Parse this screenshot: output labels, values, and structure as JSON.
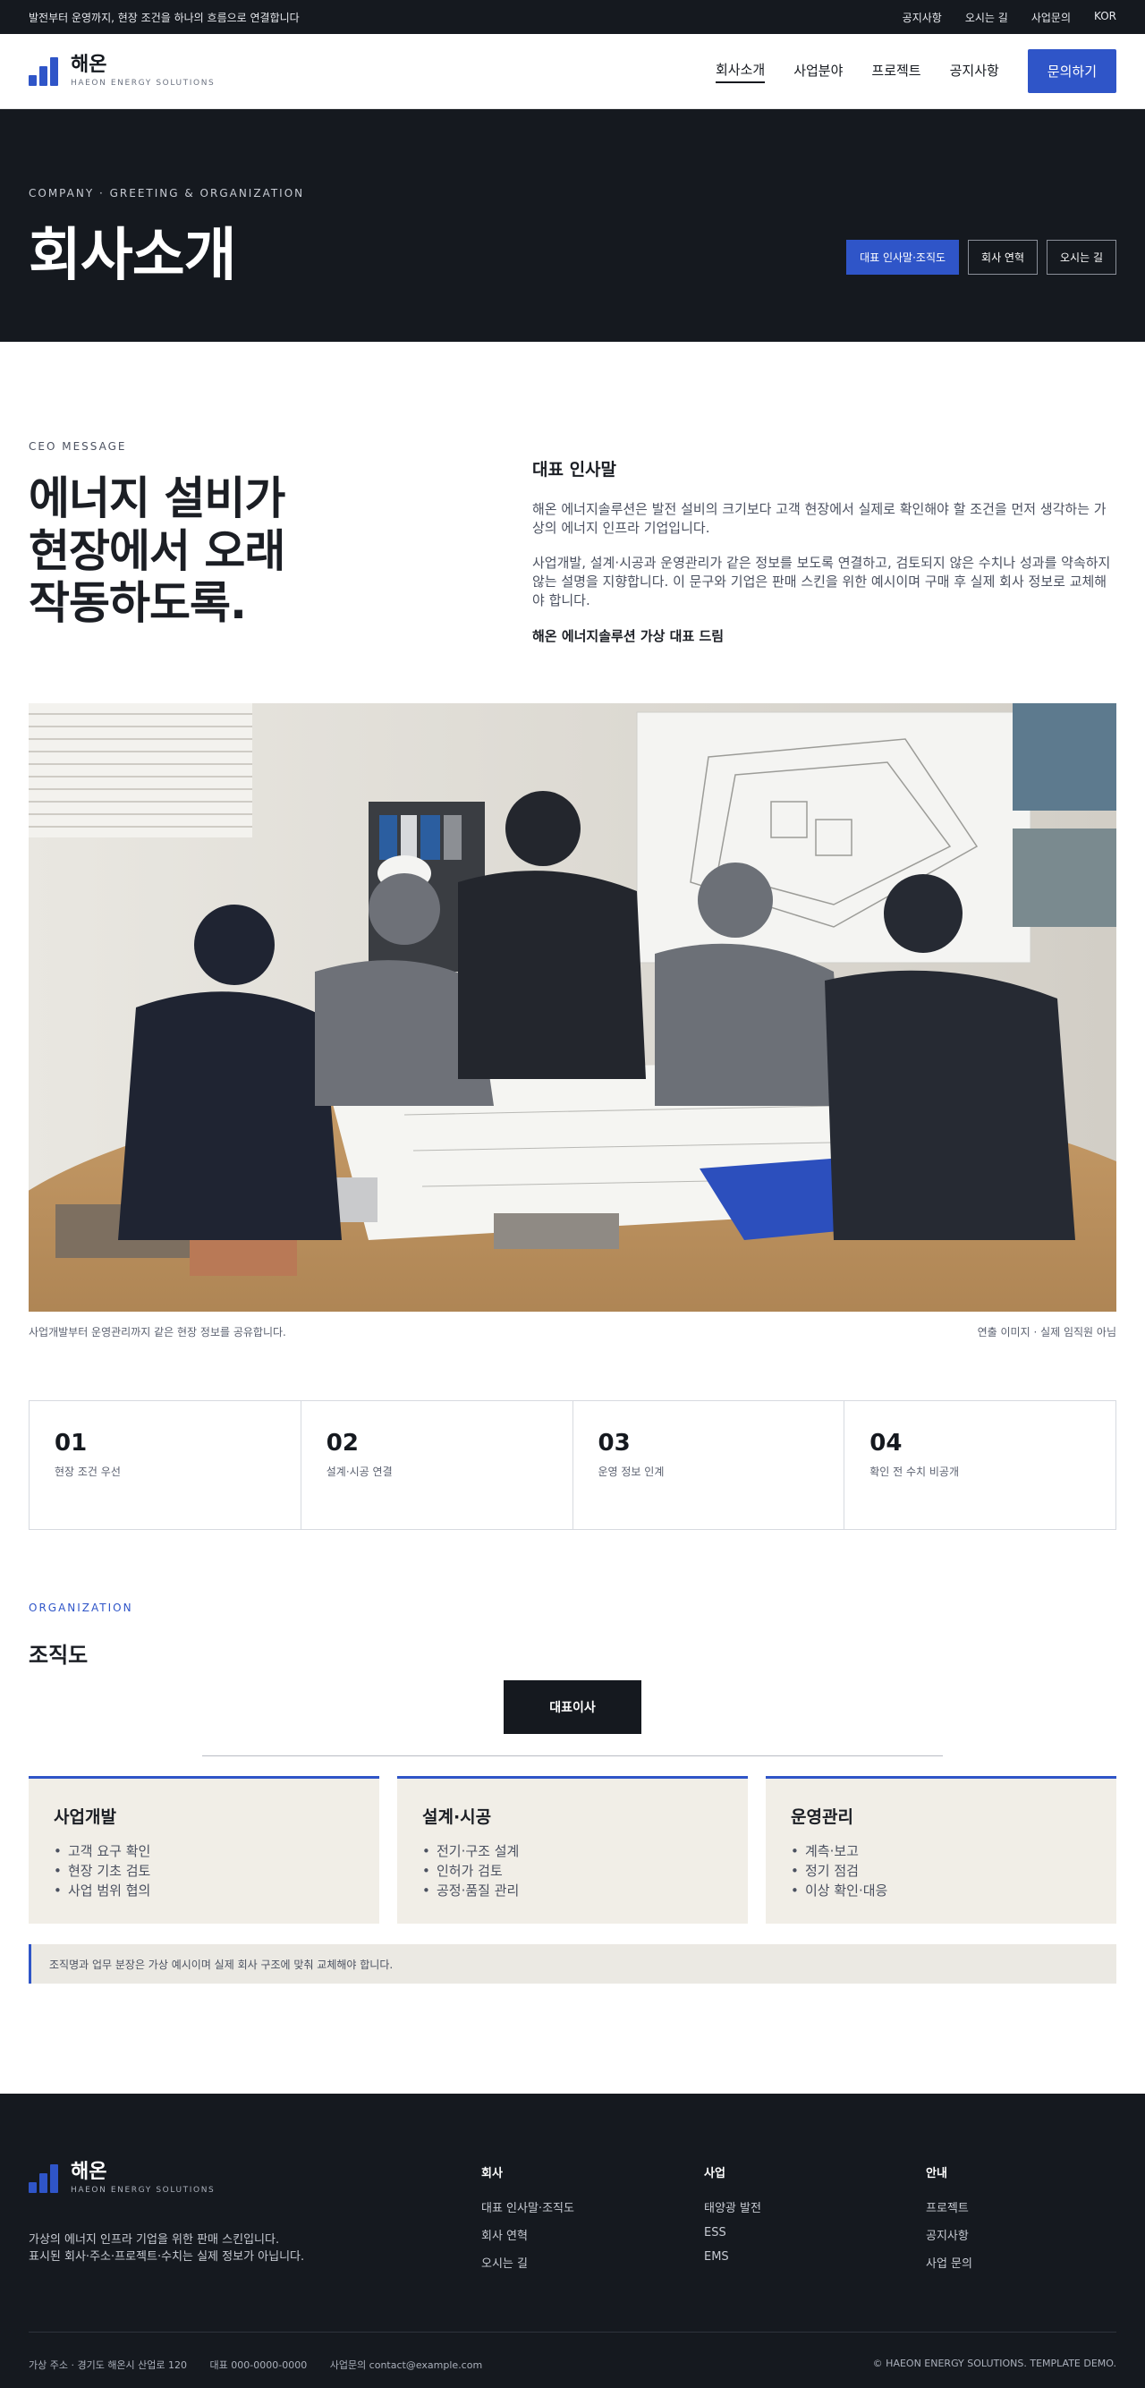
{
  "topbar": {
    "tagline": "발전부터 운영까지, 현장 조건을 하나의 흐름으로 연결합니다",
    "links": [
      "공지사항",
      "오시는 길",
      "사업문의",
      "KOR"
    ]
  },
  "header": {
    "brand_name": "해온",
    "brand_sub": "HAEON ENERGY SOLUTIONS",
    "nav": [
      "회사소개",
      "사업분야",
      "프로젝트",
      "공지사항"
    ],
    "cta": "문의하기"
  },
  "hero": {
    "eyebrow": "COMPANY · GREETING & ORGANIZATION",
    "title": "회사소개",
    "tabs": [
      "대표 인사말·조직도",
      "회사 연혁",
      "오시는 길"
    ]
  },
  "ceo": {
    "eyebrow": "CEO MESSAGE",
    "headline_lines": [
      "에너지 설비가",
      "현장에서 오래",
      "작동하도록."
    ],
    "title": "대표 인사말",
    "para1": "해온 에너지솔루션은 발전 설비의 크기보다 고객 현장에서 실제로 확인해야 할 조건을 먼저 생각하는 가상의 에너지 인프라 기업입니다.",
    "para2": "사업개발, 설계·시공과 운영관리가 같은 정보를 보도록 연결하고, 검토되지 않은 수치나 성과를 약속하지 않는 설명을 지향합니다. 이 문구와 기업은 판매 스킨을 위한 예시이며 구매 후 실제 회사 정보로 교체해야 합니다.",
    "sign": "해온 에너지솔루션 가상 대표 드림"
  },
  "photo": {
    "caption_left": "사업개발부터 운영관리까지 같은 현장 정보를 공유합니다.",
    "caption_right": "연출 이미지 · 실제 임직원 아님"
  },
  "values": [
    {
      "num": "01",
      "label": "현장 조건 우선"
    },
    {
      "num": "02",
      "label": "설계·시공 연결"
    },
    {
      "num": "03",
      "label": "운영 정보 인계"
    },
    {
      "num": "04",
      "label": "확인 전 수치 비공개"
    }
  ],
  "org": {
    "eyebrow": "ORGANIZATION",
    "title": "조직도",
    "ceo": "대표이사",
    "depts": [
      {
        "name": "사업개발",
        "items": [
          "고객 요구 확인",
          "현장 기초 검토",
          "사업 범위 협의"
        ]
      },
      {
        "name": "설계·시공",
        "items": [
          "전기·구조 설계",
          "인허가 검토",
          "공정·품질 관리"
        ]
      },
      {
        "name": "운영관리",
        "items": [
          "계측·보고",
          "정기 점검",
          "이상 확인·대응"
        ]
      }
    ],
    "note": "조직명과 업무 분장은 가상 예시이며 실제 회사 구조에 맞춰 교체해야 합니다."
  },
  "footer": {
    "brand_name": "해온",
    "brand_sub": "HAEON ENERGY SOLUTIONS",
    "desc1": "가상의 에너지 인프라 기업을 위한 판매 스킨입니다.",
    "desc2": "표시된 회사·주소·프로젝트·수치는 실제 정보가 아닙니다.",
    "cols": [
      {
        "title": "회사",
        "links": [
          "대표 인사말·조직도",
          "회사 연혁",
          "오시는 길"
        ]
      },
      {
        "title": "사업",
        "links": [
          "태양광 발전",
          "ESS",
          "EMS"
        ]
      },
      {
        "title": "안내",
        "links": [
          "프로젝트",
          "공지사항",
          "사업 문의"
        ]
      }
    ],
    "address": "가상 주소 · 경기도 해온시 산업로 120",
    "phone": "대표 000-0000-0000",
    "email": "사업문의 contact@example.com",
    "copyright": "© HAEON ENERGY SOLUTIONS. TEMPLATE DEMO."
  },
  "colors": {
    "accent": "#2f55c8",
    "dark": "#15191f",
    "beige": "#f1eee7"
  }
}
